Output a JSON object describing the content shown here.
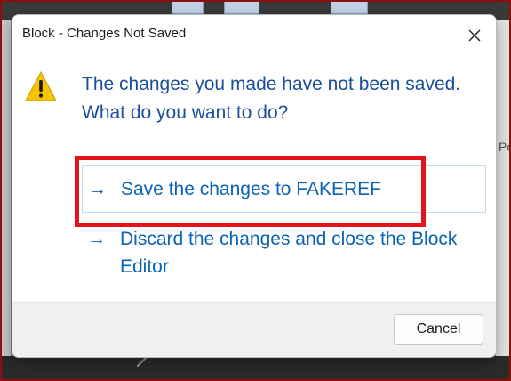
{
  "dialog": {
    "title": "Block - Changes Not Saved",
    "close_icon": "close-icon",
    "warning_icon": "warning-icon",
    "main_instruction": "The changes you made have not been saved. What do you want to do?",
    "commands": [
      {
        "arrow": "→",
        "label": "Save the changes to FAKEREF"
      },
      {
        "arrow": "→",
        "label": "Discard the changes and close the Block Editor"
      }
    ],
    "cancel_label": "Cancel"
  },
  "background": {
    "right_panel_char": "Po"
  },
  "colors": {
    "instruction_text": "#1a4f9c",
    "link_text": "#0a63b4",
    "highlight": "#e5141b",
    "footer_bg": "#f0f0f0",
    "warning_fill": "#f7c500"
  }
}
